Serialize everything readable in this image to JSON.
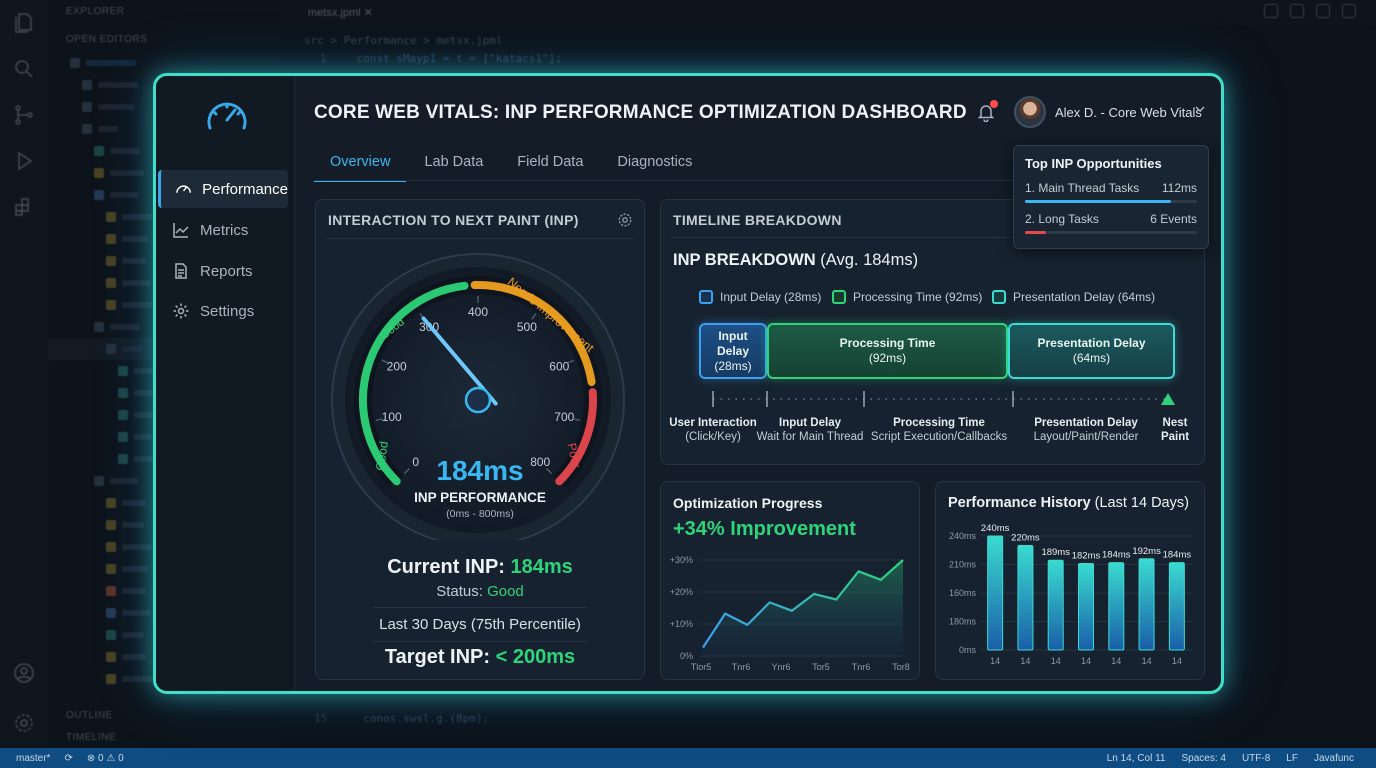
{
  "ide": {
    "explorer_header": "EXPLORER",
    "open_editors": "OPEN EDITORS",
    "outline": "OUTLINE",
    "timeline": "TIMELINE",
    "tab_file": "metsx.jpml",
    "breadcrumb": "src  >  Performance  >  metsx.jpml",
    "code_line_1": "const sMayp1 = t = [\"katacs1\"];",
    "code_line_15": "conos.swsl.g.(8pm);",
    "status_left": [
      "master*",
      "0",
      "0"
    ],
    "status_right": [
      "Ln 14, Col 11",
      "Spaces: 4",
      "UTF-8",
      "LF",
      "Javafunc"
    ]
  },
  "dashboard": {
    "title": "CORE WEB VITALS: INP PERFORMANCE OPTIMIZATION DASHBOARD",
    "user_name": "Alex D. - Core Web Vitals",
    "sidebar": [
      {
        "label": "Performance",
        "icon": "gauge-icon",
        "active": true
      },
      {
        "label": "Metrics",
        "icon": "chart-line-icon",
        "active": false
      },
      {
        "label": "Reports",
        "icon": "document-icon",
        "active": false
      },
      {
        "label": "Settings",
        "icon": "gear-icon",
        "active": false
      }
    ],
    "tabs": [
      "Overview",
      "Lab Data",
      "Field Data",
      "Diagnostics"
    ],
    "active_tab": "Overview",
    "accent_color": "#38b8f0",
    "good_color": "#2ed37a"
  },
  "inp_card": {
    "title": "INTERACTION TO NEXT PAINT (INP)",
    "value": "184ms",
    "label": "INP PERFORMANCE",
    "range": "(0ms - 800ms)",
    "ticks": [
      "0",
      "100",
      "200",
      "300",
      "400",
      "500",
      "600",
      "700",
      "800"
    ],
    "zone_good": "Good",
    "zone_good_2": "Good",
    "zone_ni": "Needs Improvement",
    "zone_poor": "Poor",
    "current_label": "Current INP: ",
    "current_value": "184ms",
    "status_label": "Status: ",
    "status_value": "Good",
    "period": "Last 30 Days (75th Percentile)",
    "target_label": "Target INP: ",
    "target_value": "< 200ms",
    "needle_value_ms": 300
  },
  "timeline_card": {
    "title": "TIMELINE BREAKDOWN",
    "heading": "INP BREAKDOWN",
    "heading_suffix": " (Avg. 184ms)",
    "legend": [
      "Input Delay (28ms)",
      "Processing Time (92ms)",
      "Presentation Delay (64ms)"
    ],
    "segments": [
      {
        "name": "Input Delay",
        "value": "(28ms)",
        "ms": 28
      },
      {
        "name": "Processing Time",
        "value": "(92ms)",
        "ms": 92
      },
      {
        "name": "Presentation Delay",
        "value": "(64ms)",
        "ms": 64
      }
    ],
    "milestones": [
      {
        "title": "User Interaction",
        "sub": "(Click/Key)"
      },
      {
        "title": "Input Delay",
        "sub": "Wait for Main Thread"
      },
      {
        "title": "Processing Time",
        "sub": "Script Execution/Callbacks"
      },
      {
        "title": "Presentation Delay",
        "sub": "Layout/Paint/Render"
      },
      {
        "title": "Nest",
        "sub": "Paint"
      }
    ]
  },
  "opportunities": {
    "title": "Top INP Opportunities",
    "items": [
      {
        "label": "1. Main Thread Tasks",
        "value": "112ms",
        "fill": 0.85,
        "color": "#38b8f0"
      },
      {
        "label": "2. Long Tasks",
        "value": "6 Events",
        "fill": 0.12,
        "color": "#e5484d"
      }
    ]
  },
  "progress_card": {
    "title": "Optimization Progress",
    "headline": "+34% Improvement",
    "chart_data": {
      "type": "area",
      "x": [
        "Tlor5",
        "Tnr6",
        "Ynr6",
        "Tor5",
        "Tnr6",
        "Tor8"
      ],
      "y_ticks": [
        "+30%",
        "+20%",
        "+10%",
        "0%"
      ],
      "ylim": [
        0,
        34
      ],
      "values": [
        3,
        15,
        11,
        19,
        16,
        22,
        20,
        30,
        27,
        34
      ]
    }
  },
  "history_card": {
    "title": "Performance History",
    "title_suffix": " (Last 14 Days)",
    "chart_data": {
      "type": "bar",
      "categories": [
        "14",
        "14",
        "14",
        "14",
        "14",
        "14",
        "14"
      ],
      "values": [
        240,
        220,
        189,
        182,
        184,
        192,
        184
      ],
      "data_labels": [
        "240ms",
        "220ms",
        "189ms",
        "182ms",
        "184ms",
        "192ms",
        "184ms"
      ],
      "y_ticks": [
        "240ms",
        "210ms",
        "160ms",
        "180ms",
        "0ms"
      ],
      "ylim": [
        0,
        240
      ]
    }
  }
}
